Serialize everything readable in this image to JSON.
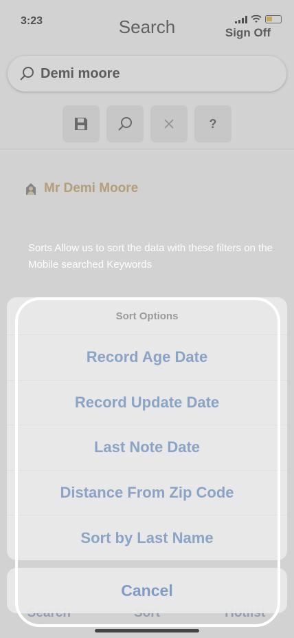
{
  "status": {
    "time": "3:23"
  },
  "header": {
    "title": "Search",
    "sign_off": "Sign Off"
  },
  "search": {
    "value": "Demi moore"
  },
  "toolbar": {
    "help_label": "?"
  },
  "results": [
    {
      "name": "Mr Demi Moore"
    }
  ],
  "tutorial": {
    "text": "Sorts Allow us to sort the data with these filters on the Mobile searched Keywords"
  },
  "sort_sheet": {
    "title": "Sort Options",
    "options": [
      "Record Age Date",
      "Record Update Date",
      "Last Note Date",
      "Distance From Zip Code",
      "Sort by Last Name"
    ],
    "cancel": "Cancel"
  },
  "tabbar": {
    "tabs": [
      "Search",
      "Sort",
      "Hotlist"
    ]
  },
  "colors": {
    "accent": "#8aa4c6",
    "result_name": "#c3aa7a",
    "highlight": "#ffffff"
  },
  "icons": [
    "save-icon",
    "search-icon",
    "close-icon",
    "help-icon",
    "person-icon",
    "wifi-icon",
    "battery-icon"
  ]
}
